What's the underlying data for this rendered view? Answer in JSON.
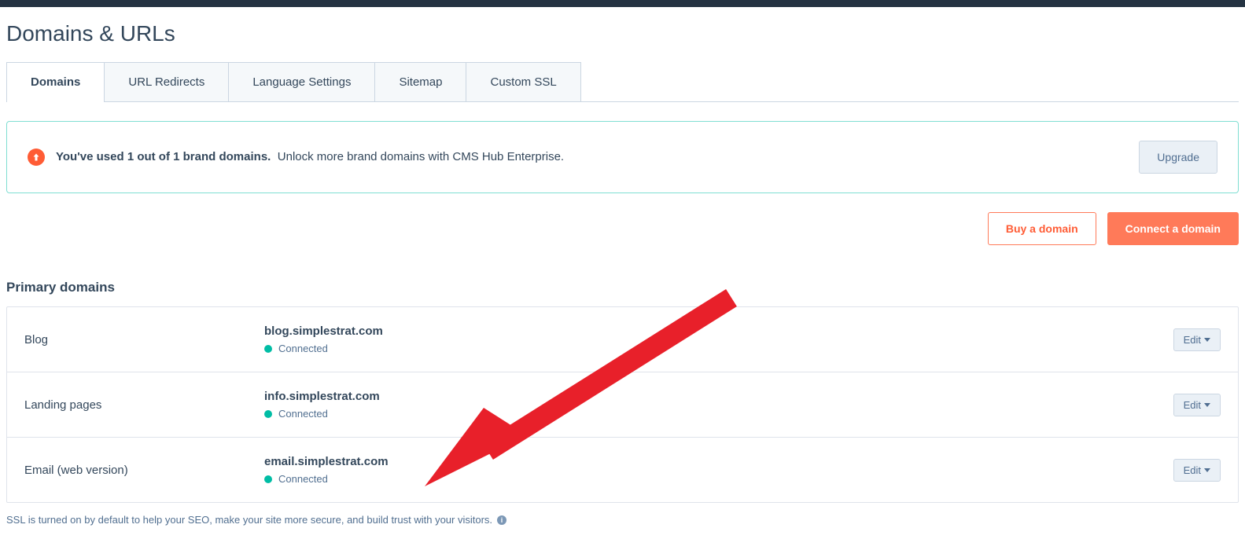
{
  "page_title": "Domains & URLs",
  "tabs": [
    {
      "label": "Domains",
      "active": true
    },
    {
      "label": "URL Redirects",
      "active": false
    },
    {
      "label": "Language Settings",
      "active": false
    },
    {
      "label": "Sitemap",
      "active": false
    },
    {
      "label": "Custom SSL",
      "active": false
    }
  ],
  "notice": {
    "bold": "You've used 1 out of 1 brand domains.",
    "text": "Unlock more brand domains with CMS Hub Enterprise.",
    "button": "Upgrade"
  },
  "actions": {
    "buy": "Buy a domain",
    "connect": "Connect a domain"
  },
  "section_title": "Primary domains",
  "domains": [
    {
      "label": "Blog",
      "name": "blog.simplestrat.com",
      "status": "Connected",
      "edit": "Edit"
    },
    {
      "label": "Landing pages",
      "name": "info.simplestrat.com",
      "status": "Connected",
      "edit": "Edit"
    },
    {
      "label": "Email (web version)",
      "name": "email.simplestrat.com",
      "status": "Connected",
      "edit": "Edit"
    }
  ],
  "footnote": "SSL is turned on by default to help your SEO, make your site more secure, and build trust with your visitors."
}
